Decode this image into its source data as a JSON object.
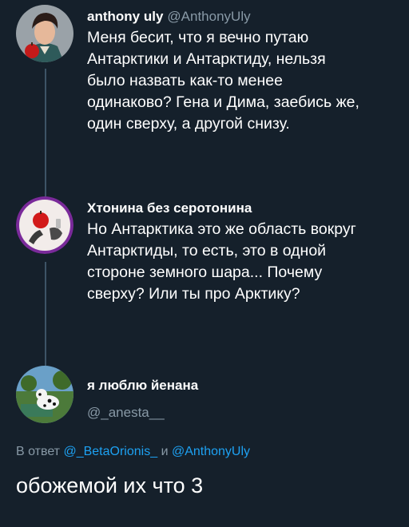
{
  "tweets": [
    {
      "display_name": "anthony uly",
      "handle": "@AnthonyUly",
      "text": "Меня бесит, что я вечно путаю\nАнтарктики и Антарктиду, нельзя\nбыло назвать как-то менее\nодинаково? Гена и Дима, заебись же,\nодин сверху, а другой снизу."
    },
    {
      "display_name": "Хтонина без серотонина",
      "text": "Но Антарктика это же область вокруг\nАнтарктиды, то есть, это в одной\nстороне земного шара... Почему\nсверху? Или ты про Арктику?"
    }
  ],
  "reply_author": {
    "display_name": "я люблю йенана",
    "handle": "@_anesta__"
  },
  "reply_context": {
    "prefix": "В ответ",
    "mention_1": "@_BetaOrionis_",
    "conjunction": "и",
    "mention_2": "@AnthonyUly"
  },
  "reply_text": "обожемой их что 3",
  "colors": {
    "background": "#15202b",
    "text": "#ffffff",
    "secondary": "#8899a6",
    "link": "#1da1f2",
    "thread_line": "#3d5466"
  }
}
